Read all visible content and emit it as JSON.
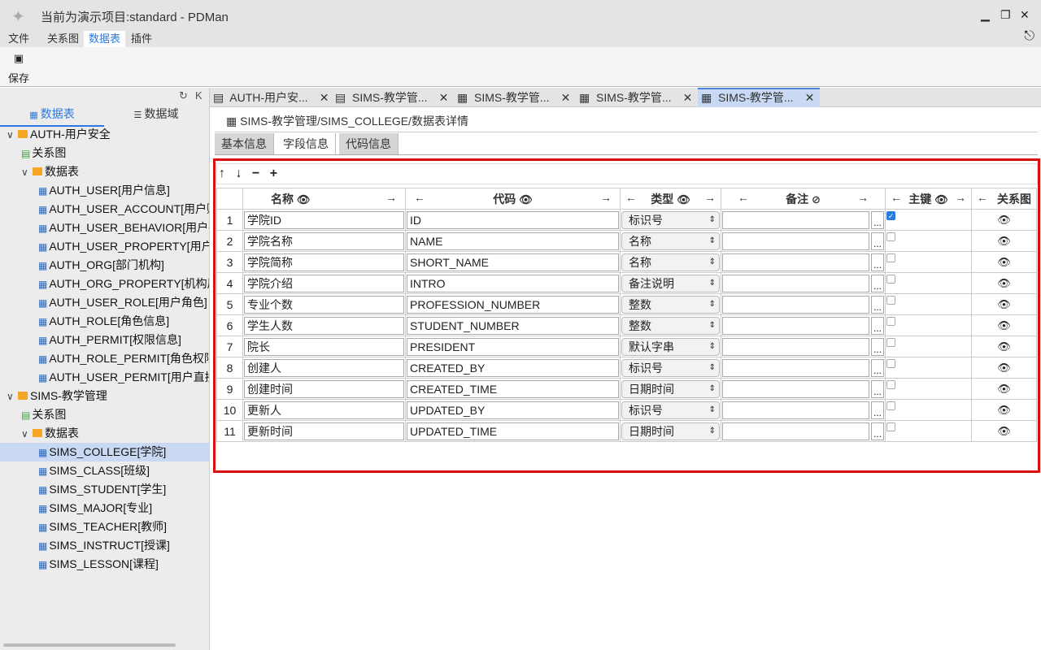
{
  "window": {
    "title": "当前为演示项目:standard - PDMan",
    "min": "▁",
    "restore": "❐",
    "close": "✕"
  },
  "menu": [
    "文件",
    "关系图",
    "数据表",
    "插件"
  ],
  "toolbar": {
    "save": "保存",
    "save_icon": "💾"
  },
  "sidebar": {
    "tabs": [
      "数据表",
      "数据域"
    ],
    "groups": [
      {
        "name": "AUTH-用户安全",
        "rel": "关系图",
        "folder": "数据表",
        "tables": [
          "AUTH_USER[用户信息]",
          "AUTH_USER_ACCOUNT[用户账",
          "AUTH_USER_BEHAVIOR[用户行",
          "AUTH_USER_PROPERTY[用户",
          "AUTH_ORG[部门机构]",
          "AUTH_ORG_PROPERTY[机构属",
          "AUTH_USER_ROLE[用户角色]",
          "AUTH_ROLE[角色信息]",
          "AUTH_PERMIT[权限信息]",
          "AUTH_ROLE_PERMIT[角色权限",
          "AUTH_USER_PERMIT[用户直接"
        ]
      },
      {
        "name": "SIMS-教学管理",
        "rel": "关系图",
        "folder": "数据表",
        "tables": [
          "SIMS_COLLEGE[学院]",
          "SIMS_CLASS[班级]",
          "SIMS_STUDENT[学生]",
          "SIMS_MAJOR[专业]",
          "SIMS_TEACHER[教师]",
          "SIMS_INSTRUCT[授课]",
          "SIMS_LESSON[课程]"
        ]
      }
    ]
  },
  "tabs": [
    "AUTH-用户安...",
    "SIMS-教学管...",
    "SIMS-教学管...",
    "SIMS-教学管...",
    "SIMS-教学管..."
  ],
  "breadcrumb": "SIMS-教学管理/SIMS_COLLEGE/数据表详情",
  "subtabs": [
    "基本信息",
    "字段信息",
    "代码信息"
  ],
  "tools": [
    "↑",
    "↓",
    "−",
    "+"
  ],
  "columns": [
    "名称",
    "代码",
    "类型",
    "备注",
    "主键",
    "关系图"
  ],
  "rows": [
    [
      "1",
      "学院ID",
      "ID",
      "标识号",
      true
    ],
    [
      "2",
      "学院名称",
      "NAME",
      "名称",
      false
    ],
    [
      "3",
      "学院简称",
      "SHORT_NAME",
      "名称",
      false
    ],
    [
      "4",
      "学院介绍",
      "INTRO",
      "备注说明",
      false
    ],
    [
      "5",
      "专业个数",
      "PROFESSION_NUMBER",
      "整数",
      false
    ],
    [
      "6",
      "学生人数",
      "STUDENT_NUMBER",
      "整数",
      false
    ],
    [
      "7",
      "院长",
      "PRESIDENT",
      "默认字串",
      false
    ],
    [
      "8",
      "创建人",
      "CREATED_BY",
      "标识号",
      false
    ],
    [
      "9",
      "创建时间",
      "CREATED_TIME",
      "日期时间",
      false
    ],
    [
      "10",
      "更新人",
      "UPDATED_BY",
      "标识号",
      false
    ],
    [
      "11",
      "更新时间",
      "UPDATED_TIME",
      "日期时间",
      false
    ]
  ]
}
